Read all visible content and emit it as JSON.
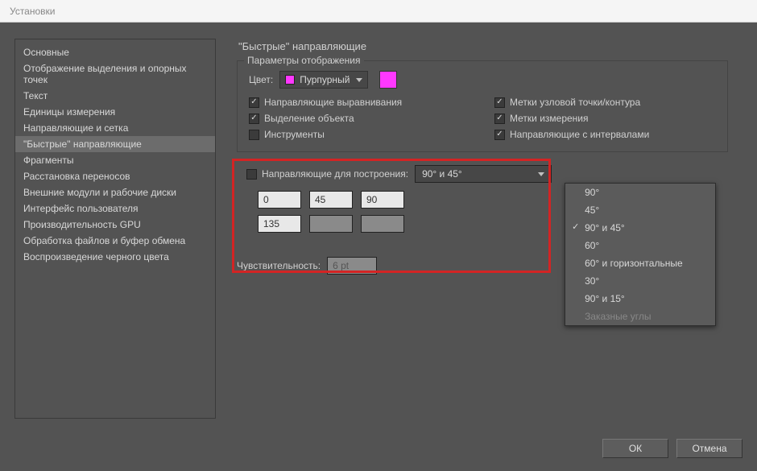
{
  "window": {
    "title": "Установки"
  },
  "sidebar": {
    "items": [
      "Основные",
      "Отображение выделения и опорных точек",
      "Текст",
      "Единицы измерения",
      "Направляющие и сетка",
      "\"Быстрые\" направляющие",
      "Фрагменты",
      "Расстановка переносов",
      "Внешние модули и рабочие диски",
      "Интерфейс пользователя",
      "Производительность GPU",
      "Обработка файлов и буфер обмена",
      "Воспроизведение черного цвета"
    ],
    "active_index": 5
  },
  "main": {
    "title": "\"Быстрые\" направляющие",
    "display_params": {
      "legend": "Параметры отображения",
      "color_label": "Цвет:",
      "color_value": "Пурпурный",
      "color_hex": "#ff38ff",
      "checks": [
        {
          "label": "Направляющие выравнивания",
          "checked": true
        },
        {
          "label": "Метки узловой точки/контура",
          "checked": true
        },
        {
          "label": "Выделение объекта",
          "checked": true
        },
        {
          "label": "Метки измерения",
          "checked": true
        },
        {
          "label": "Инструменты",
          "checked": false
        },
        {
          "label": "Направляющие с интервалами",
          "checked": true
        }
      ]
    },
    "construction": {
      "checkbox_label": "Направляющие для построения:",
      "checked": false,
      "selected_preset": "90° и 45°",
      "angles": [
        "0",
        "45",
        "90",
        "135",
        "",
        ""
      ],
      "dropdown_options": [
        {
          "label": "90°",
          "selected": false
        },
        {
          "label": "45°",
          "selected": false
        },
        {
          "label": "90° и 45°",
          "selected": true
        },
        {
          "label": "60°",
          "selected": false
        },
        {
          "label": "60° и горизонтальные",
          "selected": false
        },
        {
          "label": "30°",
          "selected": false
        },
        {
          "label": "90° и 15°",
          "selected": false
        },
        {
          "label": "Заказные углы",
          "selected": false,
          "disabled": true
        }
      ]
    },
    "sensitivity": {
      "label": "Чувствительность:",
      "value": "6 pt"
    }
  },
  "footer": {
    "ok": "ОК",
    "cancel": "Отмена"
  }
}
